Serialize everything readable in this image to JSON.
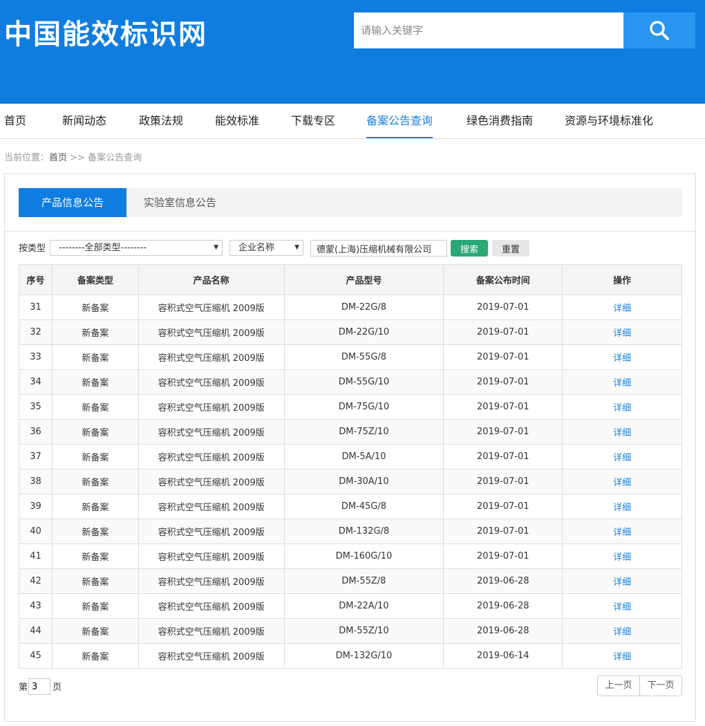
{
  "header": {
    "logo": "中国能效标识网",
    "search_placeholder": "请输入关键字",
    "search_icon": "search-icon"
  },
  "nav": {
    "items": [
      {
        "label": "首页"
      },
      {
        "label": "新闻动态"
      },
      {
        "label": "政策法规"
      },
      {
        "label": "能效标准"
      },
      {
        "label": "下载专区"
      },
      {
        "label": "备案公告查询"
      },
      {
        "label": "绿色消费指南"
      },
      {
        "label": "资源与环境标准化"
      }
    ],
    "active": "备案公告查询",
    "accent_color": "#1a7fd6"
  },
  "breadcrumb": {
    "prefix": "当前位置：",
    "home": "首页",
    "separator": " >> ",
    "current": "备案公告查询"
  },
  "tabs": {
    "product": "产品信息公告",
    "lab": "实验室信息公告"
  },
  "filters": {
    "type_label": "按类型",
    "type_value": "--------全部类型--------",
    "field_value": "企业名称",
    "keyword_value": "德蒙(上海)压缩机械有限公司",
    "search_button": "搜索",
    "reset_button": "重置"
  },
  "table": {
    "headers": [
      "序号",
      "备案类型",
      "产品名称",
      "产品型号",
      "备案公布时间",
      "操作"
    ],
    "rows": [
      [
        "31",
        "新备案",
        "容积式空气压缩机 2009版",
        "DM-22G/8",
        "2019-07-01",
        "详细"
      ],
      [
        "32",
        "新备案",
        "容积式空气压缩机 2009版",
        "DM-22G/10",
        "2019-07-01",
        "详细"
      ],
      [
        "33",
        "新备案",
        "容积式空气压缩机 2009版",
        "DM-55G/8",
        "2019-07-01",
        "详细"
      ],
      [
        "34",
        "新备案",
        "容积式空气压缩机 2009版",
        "DM-55G/10",
        "2019-07-01",
        "详细"
      ],
      [
        "35",
        "新备案",
        "容积式空气压缩机 2009版",
        "DM-75G/10",
        "2019-07-01",
        "详细"
      ],
      [
        "36",
        "新备案",
        "容积式空气压缩机 2009版",
        "DM-75Z/10",
        "2019-07-01",
        "详细"
      ],
      [
        "37",
        "新备案",
        "容积式空气压缩机 2009版",
        "DM-5A/10",
        "2019-07-01",
        "详细"
      ],
      [
        "38",
        "新备案",
        "容积式空气压缩机 2009版",
        "DM-30A/10",
        "2019-07-01",
        "详细"
      ],
      [
        "39",
        "新备案",
        "容积式空气压缩机 2009版",
        "DM-45G/8",
        "2019-07-01",
        "详细"
      ],
      [
        "40",
        "新备案",
        "容积式空气压缩机 2009版",
        "DM-132G/8",
        "2019-07-01",
        "详细"
      ],
      [
        "41",
        "新备案",
        "容积式空气压缩机 2009版",
        "DM-160G/10",
        "2019-07-01",
        "详细"
      ],
      [
        "42",
        "新备案",
        "容积式空气压缩机 2009版",
        "DM-55Z/8",
        "2019-06-28",
        "详细"
      ],
      [
        "43",
        "新备案",
        "容积式空气压缩机 2009版",
        "DM-22A/10",
        "2019-06-28",
        "详细"
      ],
      [
        "44",
        "新备案",
        "容积式空气压缩机 2009版",
        "DM-55Z/10",
        "2019-06-28",
        "详细"
      ],
      [
        "45",
        "新备案",
        "容积式空气压缩机 2009版",
        "DM-132G/10",
        "2019-06-14",
        "详细"
      ]
    ]
  },
  "pagination": {
    "prefix": "第",
    "current_page": "3",
    "suffix": "页",
    "prev": "上一页",
    "next": "下一页"
  },
  "colors": {
    "header_bg": "#0f7de0",
    "search_button_bg": "#2a95f0",
    "search_action": "#2aa876",
    "link": "#1a7fd6"
  }
}
